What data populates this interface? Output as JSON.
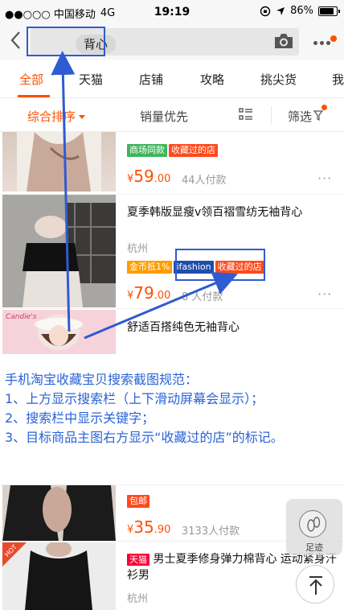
{
  "status_bar": {
    "carrier": "●●○○○ 中国移动",
    "network": "4G",
    "time": "19:19",
    "battery_pct": "86%",
    "battery_level": 0.86
  },
  "search": {
    "query": "背心",
    "back_icon": "chevron-left-icon",
    "camera_icon": "camera-icon",
    "more_icon": "more-dots-icon"
  },
  "tabs": [
    {
      "label": "全部",
      "active": true
    },
    {
      "label": "天猫"
    },
    {
      "label": "店铺"
    },
    {
      "label": "攻略"
    },
    {
      "label": "挑尖货"
    },
    {
      "label": "我"
    }
  ],
  "sort": {
    "default_label": "综合排序",
    "sales_label": "销量优先",
    "filter_label": "筛选"
  },
  "products": [
    {
      "tags": [
        "商场同款",
        "收藏过的店"
      ],
      "price_symbol": "¥",
      "price_int": "59",
      "price_dec": ".00",
      "paid": "44人付款"
    },
    {
      "title": "夏季韩版显瘦v领百褶雪纺无袖背心",
      "location": "杭州",
      "tags": [
        "金币抵1%",
        "ifashion",
        "收藏过的店"
      ],
      "price_symbol": "¥",
      "price_int": "79",
      "price_dec": ".00",
      "paid": "8   人付款"
    },
    {
      "title": "舒适百搭纯色无袖背心",
      "thumb_logo": "Candie's"
    },
    {
      "tags": [
        "包邮"
      ],
      "price_symbol": "¥",
      "price_int": "35",
      "price_dec": ".90",
      "paid": "3133人付款"
    },
    {
      "badge": "天猫",
      "title": "男士夏季修身弹力棉背心 运动紧身汗衫男",
      "location": "杭州",
      "hot": "HOT"
    }
  ],
  "note": {
    "line1": "手机淘宝收藏宝贝搜索截图规范：",
    "line2": "1、上方显示搜索栏（上下滑动屏幕会显示）；",
    "line3": "2、搜索栏中显示关键字；",
    "line4": "3、目标商品主图右方显示“收藏过的店”的标记。"
  },
  "floating": {
    "footmark_label": "足迹",
    "scroll_top_icon": "arrow-up-icon"
  },
  "colors": {
    "accent": "#ff5000",
    "annotation": "#2f5bd3",
    "tag_green": "#3fb55a",
    "tag_red": "#ff4a1c",
    "tag_orange": "#ff9c00",
    "tag_blue": "#1e4ea8"
  }
}
